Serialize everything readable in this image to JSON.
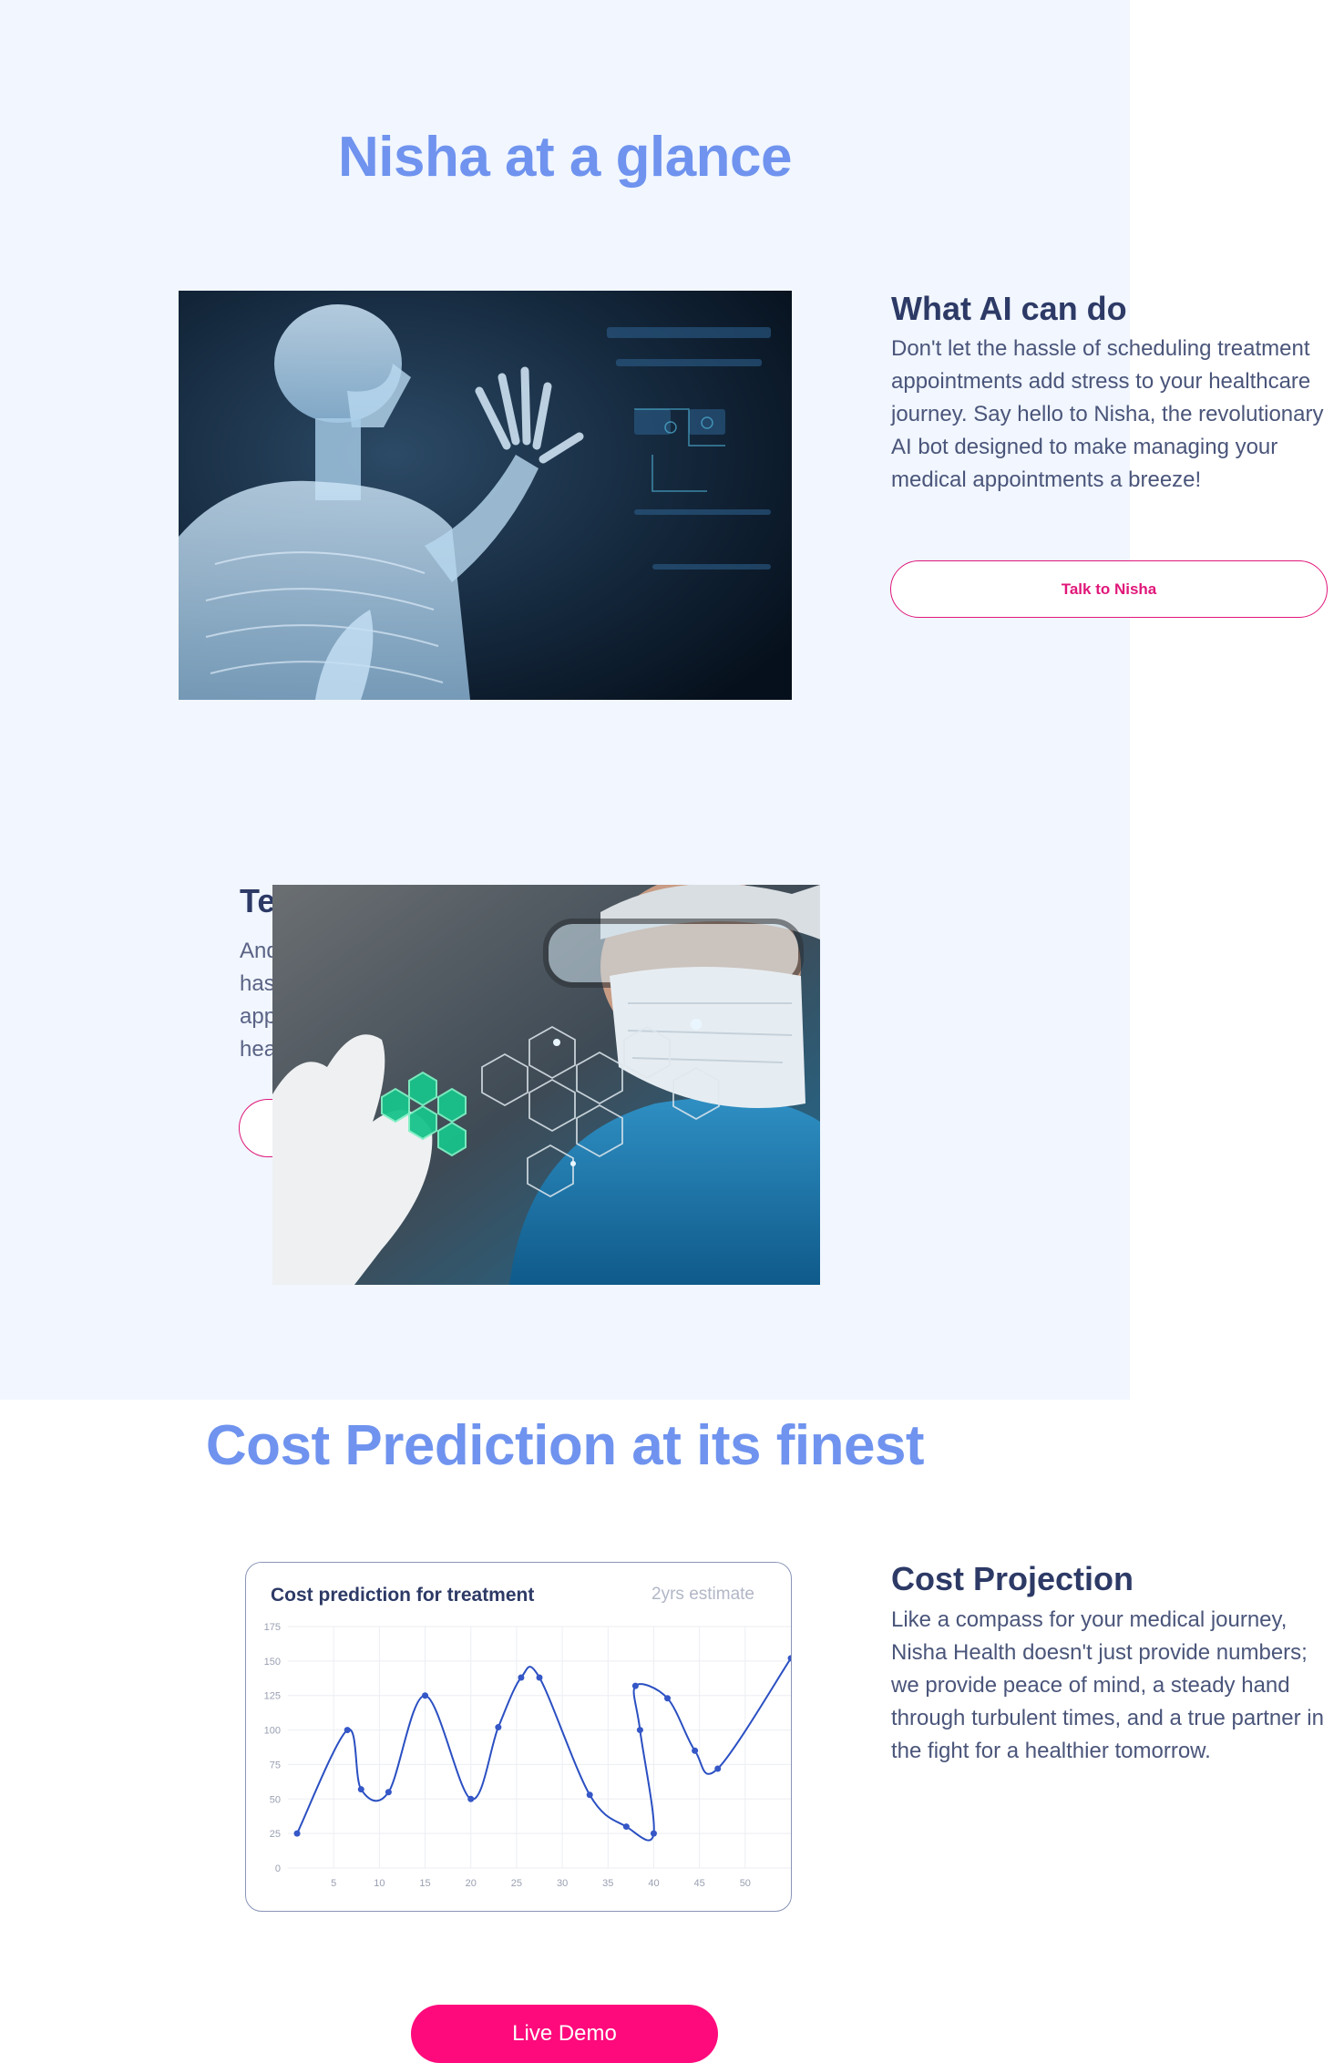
{
  "section1": {
    "title": "Nisha at a glance",
    "card1": {
      "heading": "What AI can do",
      "body": "Don't let the hassle of scheduling treatment appointments add stress to your healthcare journey. Say hello to Nisha, the revolutionary AI bot designed to make managing your medical appointments a breeze!",
      "button": "Talk to Nisha"
    },
    "card2": {
      "heading_partial": "Te",
      "body_lines_partial": [
        "And",
        "has",
        "app",
        "hea"
      ]
    }
  },
  "section2": {
    "title": "Cost Prediction at its finest",
    "card": {
      "heading": "Cost Projection",
      "body": "Like a compass for your medical journey, Nisha Health doesn't just provide numbers; we provide peace of mind, a steady hand through turbulent times, and a true partner in the fight for a healthier tomorrow."
    },
    "chart_title": "Cost prediction for treatment",
    "chart_subtitle": "2yrs estimate"
  },
  "cta": {
    "label": "Live Demo"
  },
  "colors": {
    "accent": "#6f93ee",
    "heading": "#2d3a66",
    "pink": "#ff0a7c",
    "panel": "#f1f6ff"
  },
  "icons": [
    "skeleton-hologram-image",
    "doctor-hexagon-image"
  ],
  "chart_data": {
    "type": "line",
    "title": "Cost prediction for treatment",
    "subtitle": "2yrs estimate",
    "xlabel": "",
    "ylabel": "",
    "xlim": [
      0,
      55
    ],
    "ylim": [
      0,
      175
    ],
    "x_ticks": [
      5,
      10,
      15,
      20,
      25,
      30,
      35,
      40,
      45,
      50
    ],
    "y_ticks": [
      0,
      25,
      50,
      75,
      100,
      125,
      150,
      175
    ],
    "grid": true,
    "series": [
      {
        "x": [
          1,
          6.5,
          8,
          11,
          15,
          20,
          23,
          25.5,
          27.5,
          33,
          37,
          40,
          38.5,
          38,
          41.5,
          44.5,
          47,
          55
        ],
        "y": [
          25,
          100,
          57,
          55,
          125,
          50,
          102,
          138,
          138,
          53,
          30,
          25,
          100,
          132,
          123,
          85,
          72,
          152
        ]
      }
    ]
  }
}
